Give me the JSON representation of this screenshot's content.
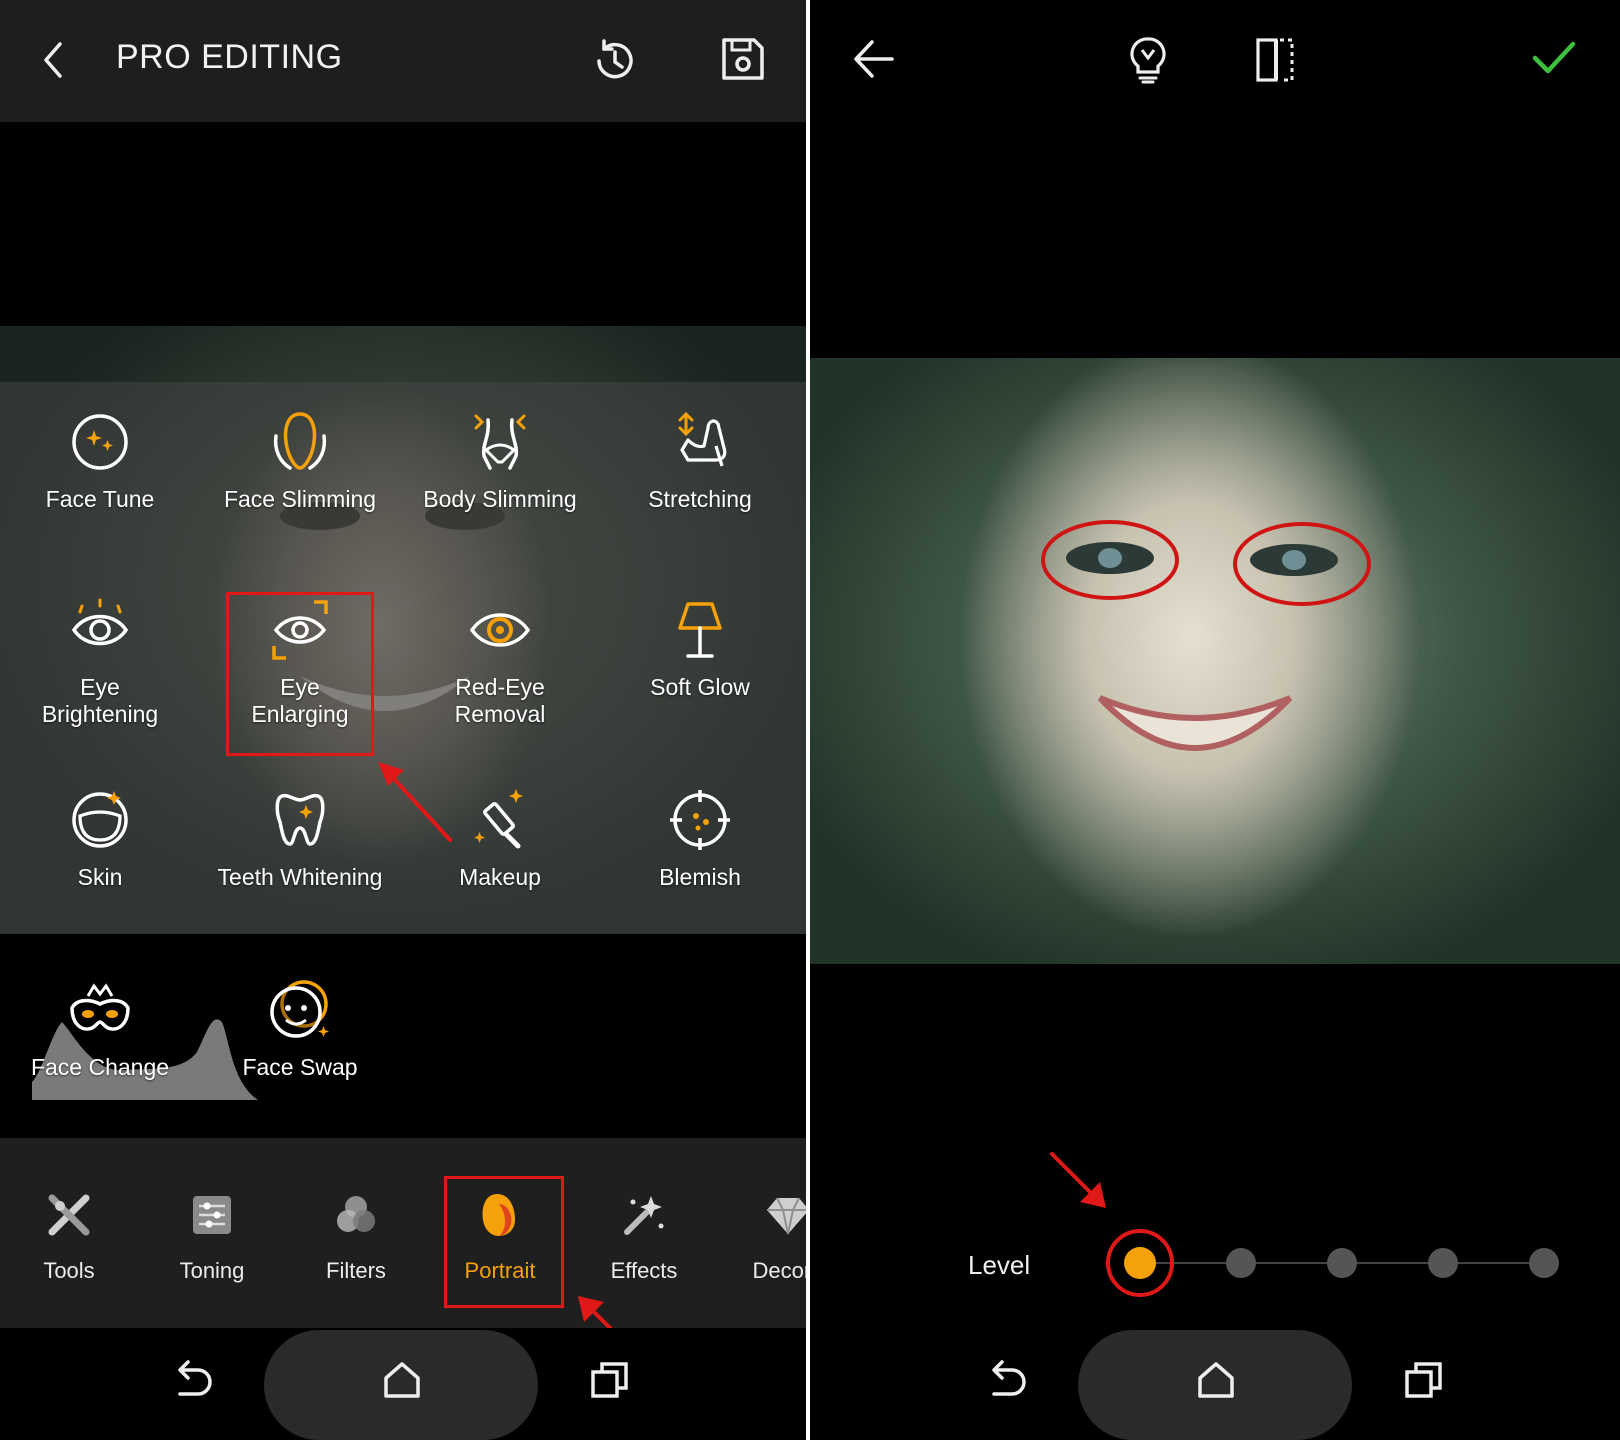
{
  "left": {
    "header": {
      "title": "PRO EDITING"
    },
    "tools": [
      {
        "label": "Face Tune",
        "icon": "face-tune-icon"
      },
      {
        "label": "Face Slimming",
        "icon": "face-slimming-icon"
      },
      {
        "label": "Body Slimming",
        "icon": "body-slimming-icon"
      },
      {
        "label": "Stretching",
        "icon": "stretching-icon"
      },
      {
        "label": "Eye\nBrightening",
        "icon": "eye-brightening-icon"
      },
      {
        "label": "Eye\nEnlarging",
        "icon": "eye-enlarging-icon"
      },
      {
        "label": "Red-Eye\nRemoval",
        "icon": "red-eye-removal-icon"
      },
      {
        "label": "Soft Glow",
        "icon": "soft-glow-icon"
      },
      {
        "label": "Skin",
        "icon": "skin-icon"
      },
      {
        "label": "Teeth Whitening",
        "icon": "teeth-whitening-icon"
      },
      {
        "label": "Makeup",
        "icon": "makeup-icon"
      },
      {
        "label": "Blemish",
        "icon": "blemish-icon"
      },
      {
        "label": "Face Change",
        "icon": "face-change-icon"
      },
      {
        "label": "Face Swap",
        "icon": "face-swap-icon"
      }
    ],
    "categories": [
      {
        "label": "Tools",
        "icon": "tools-icon"
      },
      {
        "label": "Toning",
        "icon": "toning-icon"
      },
      {
        "label": "Filters",
        "icon": "filters-icon"
      },
      {
        "label": "Portrait",
        "icon": "portrait-icon",
        "active": true
      },
      {
        "label": "Effects",
        "icon": "effects-icon"
      },
      {
        "label": "Decora",
        "icon": "decor-icon"
      }
    ]
  },
  "right": {
    "level": {
      "label": "Level",
      "steps": 5,
      "selected": 1
    }
  },
  "colors": {
    "accent": "#f5a10a",
    "confirm": "#3fbf3f",
    "highlight": "#e01818",
    "inactive_dot": "#555555"
  }
}
